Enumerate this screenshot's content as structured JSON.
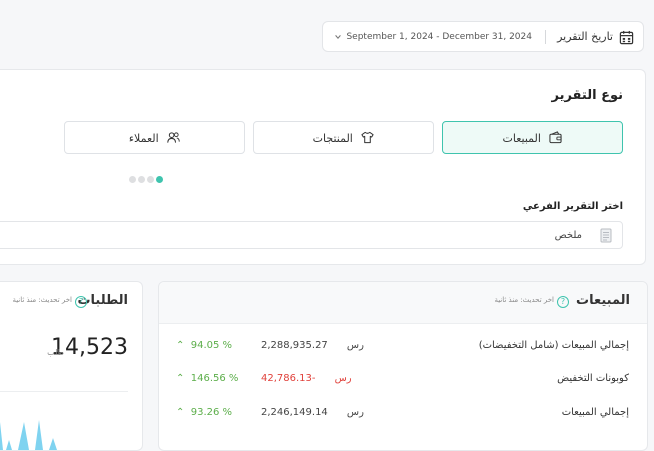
{
  "date_filter": {
    "label": "تاريخ التقرير",
    "range": "September 1, 2024 - December 31, 2024"
  },
  "report_type": {
    "title": "نوع التقرير",
    "options": [
      {
        "label": "المبيعات",
        "icon": "wallet-icon",
        "active": true
      },
      {
        "label": "المنتجات",
        "icon": "shirt-icon",
        "active": false
      },
      {
        "label": "العملاء",
        "icon": "users-icon",
        "active": false
      }
    ],
    "pager_dots": 4,
    "active_dot": 4
  },
  "sub_report": {
    "label": "اختر التقرير الفرعي",
    "selected": "ملخص"
  },
  "sales_card": {
    "title": "المبيعات",
    "help_icon": "?",
    "updated": "اخر تحديث: منذ ثانية",
    "rows": [
      {
        "label": "إجمالي المبيعات (شامل التخفيضات)",
        "value": "2,288,935.27",
        "currency": "رس",
        "pct": "94.05 %",
        "negative": false
      },
      {
        "label": "كوبونات التخفيض",
        "value": "-42,786.13",
        "currency": "رس",
        "pct": "146.56 %",
        "negative": true
      },
      {
        "label": "إجمالي المبيعات",
        "value": "2,246,149.14",
        "currency": "رس",
        "pct": "93.26 %",
        "negative": false
      }
    ]
  },
  "orders_card": {
    "title": "الطلبات",
    "help_icon": "?",
    "updated": "اخر تحديث: منذ ثانية",
    "value": "14,523",
    "unit": "طلب"
  },
  "colors": {
    "accent": "#3fc4ae",
    "positive": "#5cae4a",
    "negative": "#e0413b",
    "spark": "#7fd3f0"
  }
}
